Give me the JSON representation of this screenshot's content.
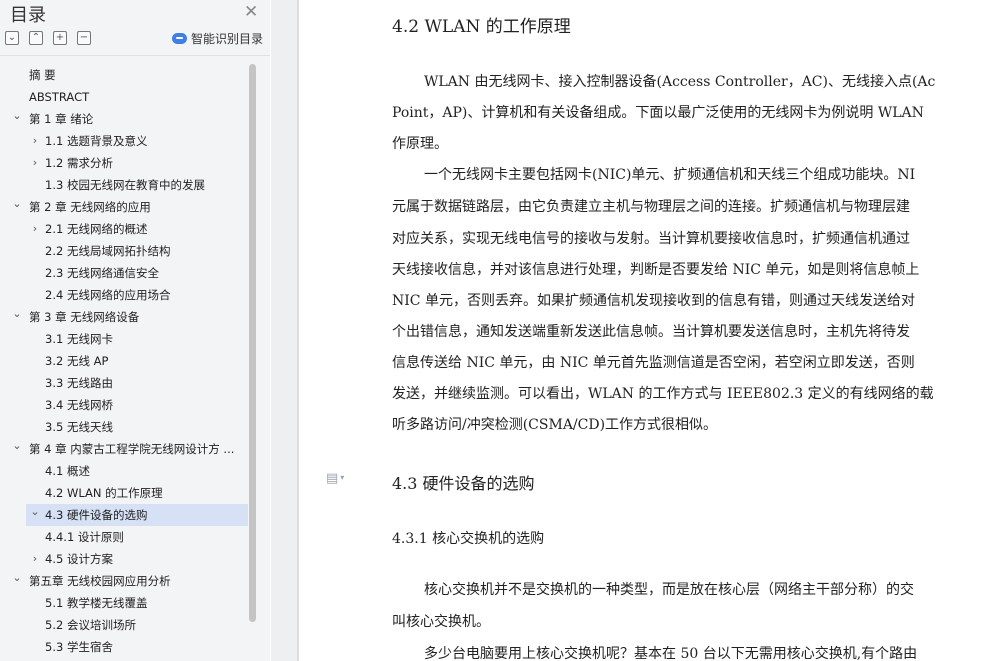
{
  "nav": {
    "title": "目录",
    "smart_toc_label": "智能识别目录",
    "items": [
      {
        "label": "摘    要",
        "level": 1,
        "arrow": ""
      },
      {
        "label": "ABSTRACT",
        "level": 1,
        "arrow": ""
      },
      {
        "label": "第 1 章  绪论",
        "level": 1,
        "arrow": "down"
      },
      {
        "label": "1.1 选题背景及意义",
        "level": 2,
        "arrow": "right"
      },
      {
        "label": "1.2 需求分析",
        "level": 2,
        "arrow": "right"
      },
      {
        "label": "1.3 校园无线网在教育中的发展",
        "level": 2,
        "arrow": ""
      },
      {
        "label": "第 2 章  无线网络的应用",
        "level": 1,
        "arrow": "down"
      },
      {
        "label": "2.1 无线网络的概述",
        "level": 2,
        "arrow": "right"
      },
      {
        "label": "2.2 无线局域网拓扑结构",
        "level": 2,
        "arrow": ""
      },
      {
        "label": "2.3 无线网络通信安全",
        "level": 2,
        "arrow": ""
      },
      {
        "label": "2.4 无线网络的应用场合",
        "level": 2,
        "arrow": ""
      },
      {
        "label": "第 3 章  无线网络设备",
        "level": 1,
        "arrow": "down"
      },
      {
        "label": "3.1 无线网卡",
        "level": 2,
        "arrow": ""
      },
      {
        "label": "3.2 无线 AP",
        "level": 2,
        "arrow": ""
      },
      {
        "label": "3.3 无线路由",
        "level": 2,
        "arrow": ""
      },
      {
        "label": "3.4 无线网桥",
        "level": 2,
        "arrow": ""
      },
      {
        "label": "3.5 无线天线",
        "level": 2,
        "arrow": ""
      },
      {
        "label": "第 4 章  内蒙古工程学院无线网设计方 ...",
        "level": 1,
        "arrow": "down"
      },
      {
        "label": "4.1 概述",
        "level": 2,
        "arrow": ""
      },
      {
        "label": "4.2 WLAN 的工作原理",
        "level": 2,
        "arrow": ""
      },
      {
        "label": "4.3 硬件设备的选购",
        "level": 2,
        "arrow": "down",
        "selected": true
      },
      {
        "label": "4.4.1 设计原则",
        "level": 2,
        "arrow": ""
      },
      {
        "label": "4.5 设计方案",
        "level": 2,
        "arrow": "right"
      },
      {
        "label": "第五章  无线校园网应用分析",
        "level": 1,
        "arrow": "down"
      },
      {
        "label": "5.1 教学楼无线覆盖",
        "level": 2,
        "arrow": ""
      },
      {
        "label": "5.2 会议培训场所",
        "level": 2,
        "arrow": ""
      },
      {
        "label": "5.3 学生宿舍",
        "level": 2,
        "arrow": ""
      }
    ]
  },
  "doc": {
    "h_4_2": "4.2 WLAN 的工作原理",
    "lines": [
      "WLAN 由无线网卡、接入控制器设备(Access Controller，AC)、无线接入点(Ac",
      "Point，AP)、计算机和有关设备组成。下面以最广泛使用的无线网卡为例说明 WLAN",
      "作原理。",
      "一个无线网卡主要包括网卡(NIC)单元、扩频通信机和天线三个组成功能块。NI",
      "元属于数据链路层，由它负责建立主机与物理层之间的连接。扩频通信机与物理层建",
      "对应关系，实现无线电信号的接收与发射。当计算机要接收信息时，扩频通信机通过",
      "天线接收信息，并对该信息进行处理，判断是否要发给 NIC 单元，如是则将信息帧上",
      "NIC 单元，否则丢弃。如果扩频通信机发现接收到的信息有错，则通过天线发送给对",
      "个出错信息，通知发送端重新发送此信息帧。当计算机要发送信息时，主机先将待发",
      "信息传送给 NIC 单元，由 NIC 单元首先监测信道是否空闲，若空闲立即发送，否则",
      "发送，并继续监测。可以看出，WLAN 的工作方式与 IEEE802.3 定义的有线网络的载",
      "听多路访问/冲突检测(CSMA/CD)工作方式很相似。"
    ],
    "h_4_3": "4.3 硬件设备的选购",
    "h_4_3_1": "4.3.1 核心交换机的选购",
    "lines2": [
      "核心交换机并不是交换机的一种类型，而是放在核心层（网络主干部分称）的交",
      "叫核心交换机。",
      "多少台电脑要用上核心交换机呢？基本在 50 台以下无需用核心交换机,有个路由"
    ]
  }
}
